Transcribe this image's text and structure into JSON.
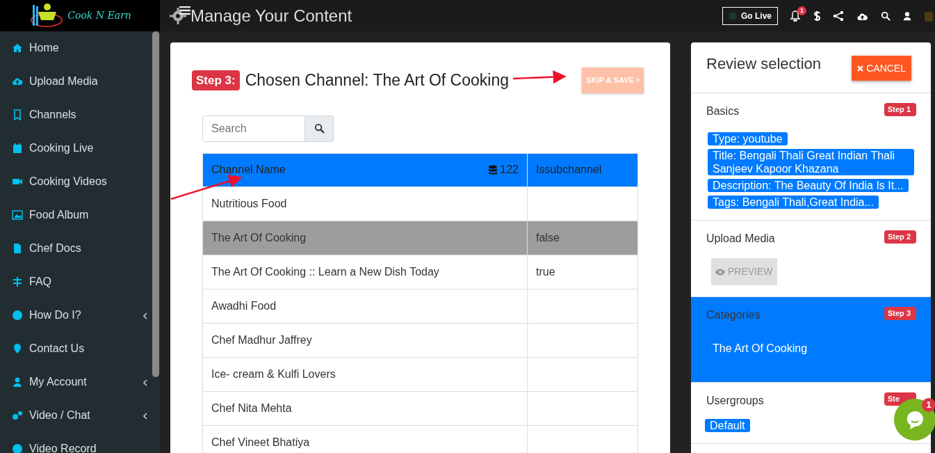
{
  "brand": {
    "name": "Cook N Earn"
  },
  "page_title": "Manage Your Content",
  "topbar": {
    "go_live": "Go Live",
    "live": false,
    "notifications": "1"
  },
  "sidebar": {
    "items": [
      {
        "label": "Home",
        "submenu": false
      },
      {
        "label": "Upload Media",
        "submenu": false
      },
      {
        "label": "Channels",
        "submenu": false
      },
      {
        "label": "Cooking Live",
        "submenu": false
      },
      {
        "label": "Cooking Videos",
        "submenu": false
      },
      {
        "label": "Food Album",
        "submenu": false
      },
      {
        "label": "Chef Docs",
        "submenu": false
      },
      {
        "label": "FAQ",
        "submenu": false
      },
      {
        "label": "How Do I?",
        "submenu": true
      },
      {
        "label": "Contact Us",
        "submenu": false
      },
      {
        "label": "My Account",
        "submenu": true
      },
      {
        "label": "Video / Chat",
        "submenu": true
      },
      {
        "label": "Video Record",
        "submenu": false
      }
    ]
  },
  "step": {
    "badge": "Step 3:",
    "title": "Chosen Channel: The Art Of Cooking",
    "skip_button": "SKIP & SAVE"
  },
  "search": {
    "placeholder": "Search"
  },
  "table": {
    "columns": [
      {
        "label": "Channel Name",
        "count": "122"
      },
      {
        "label": "Issubchannel"
      }
    ],
    "rows": [
      {
        "name": "Nutritious Food",
        "selected": false
      },
      {
        "name": "The Art Of Cooking",
        "issubchannel": "false",
        "selected": true
      },
      {
        "name": "The Art Of Cooking :: Learn a New Dish Today",
        "issubchannel": "true",
        "selected": false
      },
      {
        "name": "Awadhi Food",
        "selected": false
      },
      {
        "name": "Chef Madhur Jaffrey",
        "selected": false
      },
      {
        "name": "Ice- cream & Kulfi Lovers",
        "selected": false
      },
      {
        "name": "Chef Nita Mehta",
        "selected": false
      },
      {
        "name": "Chef Vineet Bhatiya",
        "selected": false
      }
    ]
  },
  "review": {
    "title": "Review selection",
    "cancel": "CANCEL",
    "sections": [
      {
        "title": "Basics",
        "step": "Step 1",
        "selected": false,
        "kind": "tags",
        "tags": [
          "Type: youtube",
          "Title: Bengali Thali Great Indian Thali Sanjeev Kapoor Khazana",
          "Description: The Beauty Of India Is It...",
          "Tags: Bengali Thali,Great India..."
        ]
      },
      {
        "title": "Upload Media",
        "step": "Step 2",
        "selected": false,
        "kind": "button",
        "button": "PREVIEW"
      },
      {
        "title": "Categories",
        "step": "Step 3",
        "selected": true,
        "kind": "text",
        "text": "The Art Of Cooking"
      },
      {
        "title": "Usergroups",
        "step": "Ste",
        "selected": false,
        "kind": "tags",
        "tags": [
          "Default"
        ]
      }
    ]
  },
  "chat": {
    "badge": "1"
  }
}
